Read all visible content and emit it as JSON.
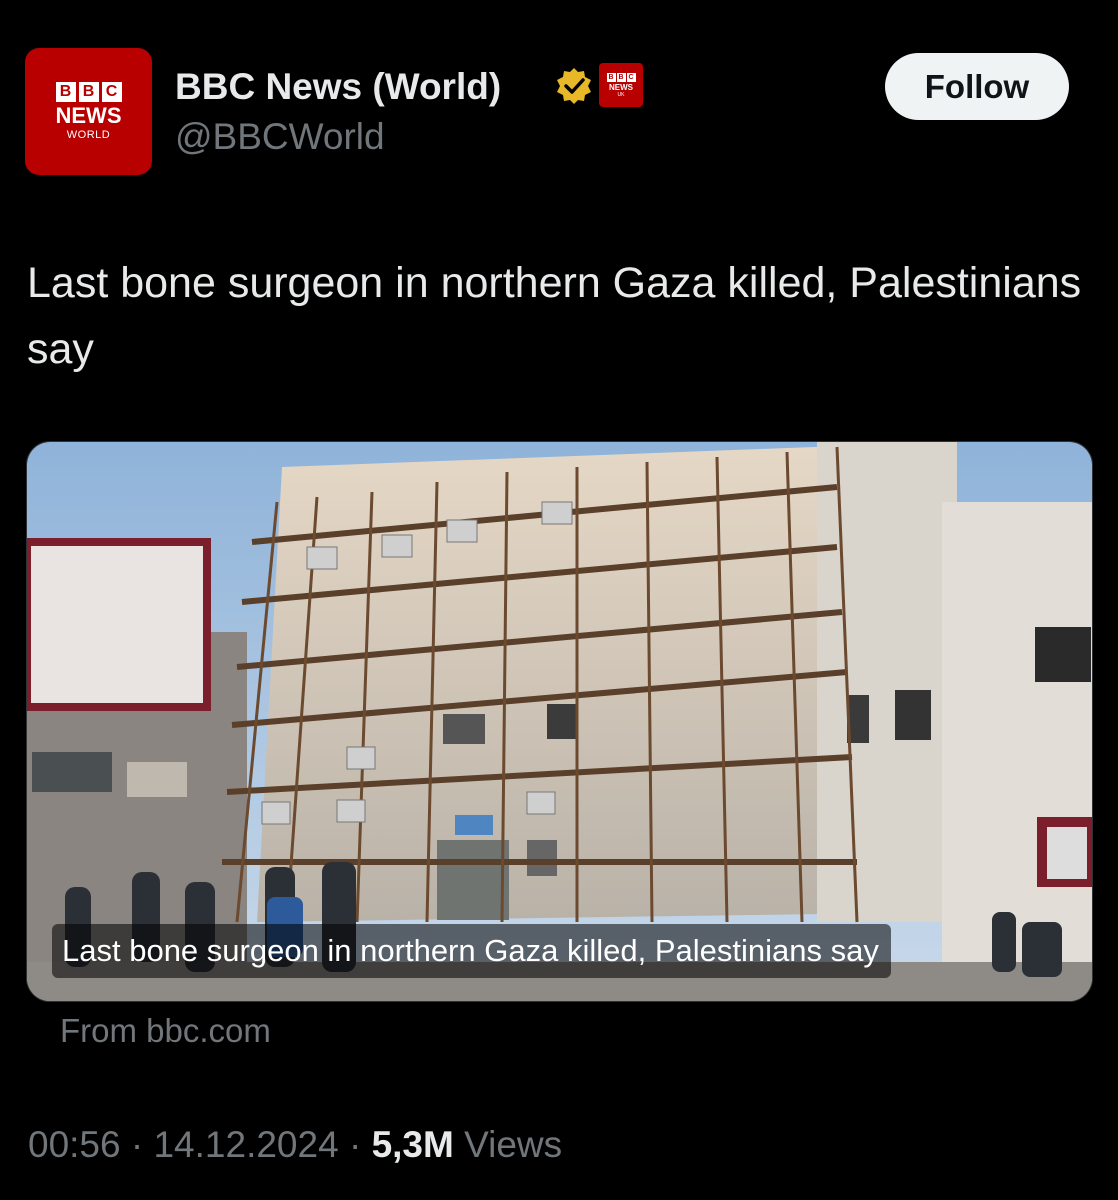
{
  "author": {
    "avatar_line1_letters": [
      "B",
      "B",
      "C"
    ],
    "avatar_line2": "NEWS",
    "avatar_line3": "WORLD",
    "name": "BBC News (World)",
    "handle": "@BBCWorld",
    "verified_icon": "gold-verified-check-icon",
    "affiliate_badge": {
      "letters": [
        "B",
        "B",
        "C"
      ],
      "line2": "NEWS",
      "line3": "UK"
    }
  },
  "follow_label": "Follow",
  "tweet_text": "Last bone surgeon in northern Gaza killed, Palestinians say",
  "media": {
    "caption": "Last bone surgeon in northern Gaza killed, Palestinians say",
    "source": "From bbc.com"
  },
  "meta": {
    "time": "00:56",
    "separator": "·",
    "date": "14.12.2024",
    "views_count": "5,3M",
    "views_label": "Views"
  },
  "colors": {
    "background": "#000000",
    "bbc_red": "#b80000",
    "text_primary": "#e7e9ea",
    "text_secondary": "#71767b",
    "verified_gold": "#e8b829"
  }
}
